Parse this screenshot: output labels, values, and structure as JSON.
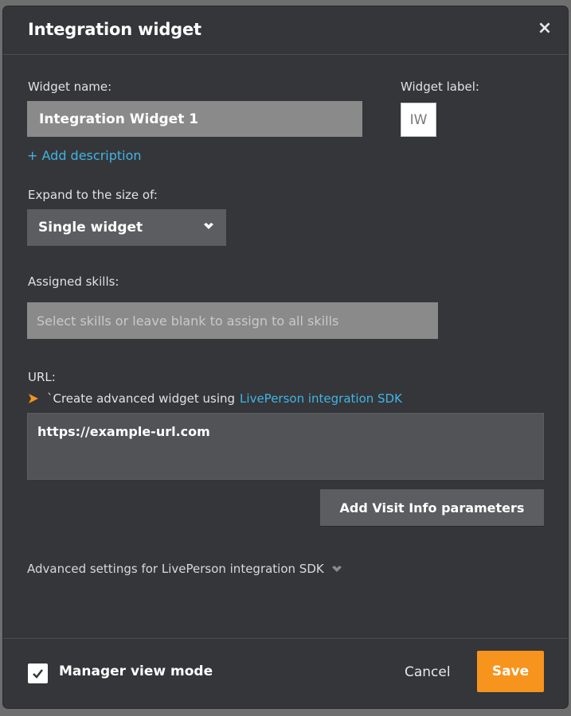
{
  "dialog": {
    "title": "Integration widget",
    "close_symbol": "×"
  },
  "widget_name": {
    "label": "Widget name:",
    "value": "Integration Widget  1"
  },
  "widget_label": {
    "label": "Widget label:",
    "value": "IW"
  },
  "add_description": "+ Add description",
  "expand": {
    "label": "Expand to the size of:",
    "selected": "Single widget"
  },
  "skills": {
    "label": "Assigned skills:",
    "placeholder": "Select skills or leave blank to assign to all skills"
  },
  "url": {
    "label": "URL:",
    "sdk_prefix": "`Create advanced widget using",
    "sdk_link": "LivePerson integration SDK",
    "value": "https://example-url.com"
  },
  "visit_info_button": "Add Visit Info parameters",
  "advanced_settings": "Advanced settings for LivePerson integration SDK",
  "footer": {
    "manager_view_label": "Manager view mode",
    "manager_view_checked": true,
    "cancel_label": "Cancel",
    "save_label": "Save"
  },
  "icons": {
    "close": "close-icon",
    "dropdown": "chevron-down-icon",
    "arrow": "arrow-right-icon",
    "check": "check-icon"
  },
  "colors": {
    "background": "#35363a",
    "accent_link": "#3fb6e3",
    "save_button": "#f7941d",
    "arrow": "#f7941d"
  }
}
